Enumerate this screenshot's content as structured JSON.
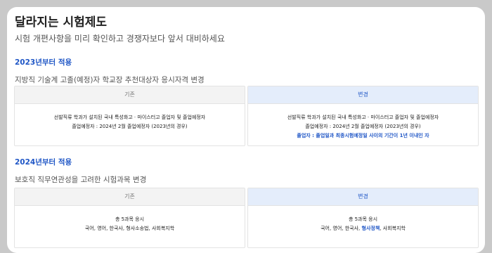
{
  "page": {
    "title": "달라지는 시험제도",
    "subtitle": "시험 개편사항을 미리 확인하고 경쟁자보다 앞서 대비하세요"
  },
  "sections": [
    {
      "title": "2023년부터 적용",
      "desc": "지방직 기술계 고졸(예정)자 학교장 추천대상자 응시자격 변경",
      "before": {
        "label": "기존",
        "line1": "선발직류 학과가 설치된 국내 특성화고 · 마이스터고 졸업자 및 졸업예정자",
        "line2": "졸업예정자 : 2024년 2월 졸업예정자 (2023년의 경우)"
      },
      "after": {
        "label": "변경",
        "line1": "선발직류 학과가 설치된 국내 특성화고 · 마이스터고 졸업자 및 졸업예정자",
        "line2": "졸업예정자 : 2024년 2월 졸업예정자 (2023년의 경우)",
        "line3": "졸업자 : 졸업일과 최종시험예정일 사이의 기간이 1년 이내인 자"
      }
    },
    {
      "title": "2024년부터 적용",
      "desc": "보호직 직무연관성을 고려한 시험과목 변경",
      "before": {
        "label": "기존",
        "line1": "총 5과목 응시",
        "line2": "국어, 영어, 한국사, 형사소송법, 사회복지학"
      },
      "after": {
        "label": "변경",
        "line1": "총 5과목 응시",
        "line2_pre": "국어, 영어, 한국사, ",
        "line2_highlight": "형사정책",
        "line2_post": ", 사회복지학"
      }
    }
  ],
  "colors": {
    "accent": "#1f56c6",
    "after_header_bg": "#e4edfb",
    "before_header_bg": "#f3f3f3",
    "frame_bg": "#c9c9c9"
  }
}
